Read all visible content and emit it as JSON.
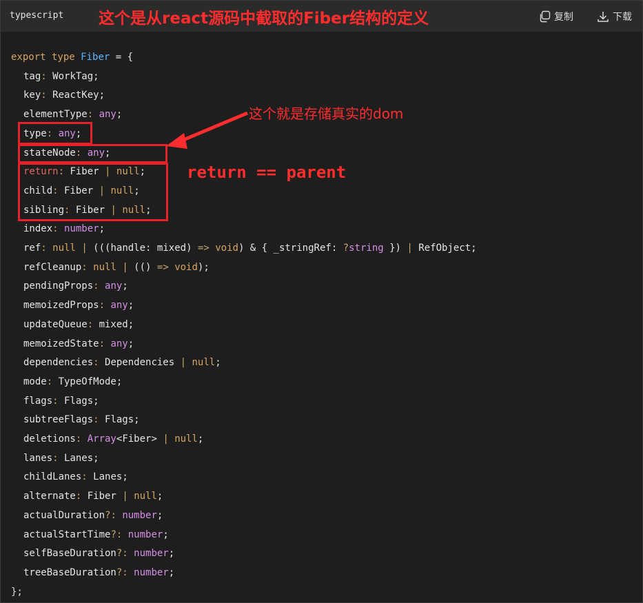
{
  "header": {
    "language": "typescript",
    "annotation": "这个是从react源码中截取的Fiber结构的定义",
    "copy_label": "复制",
    "download_label": "下载"
  },
  "annotations": {
    "dom_note": "这个就是存储真实的dom",
    "parent_note": "return == parent"
  },
  "code": {
    "open": {
      "kw": "export type",
      "name": "Fiber",
      "eq": "= {"
    },
    "fields": [
      {
        "name": "tag",
        "type": "WorkTag;"
      },
      {
        "name": "key",
        "type": "ReactKey;"
      },
      {
        "name": "elementType",
        "type": "any;"
      },
      {
        "name": "type",
        "type": "any;"
      },
      {
        "name": "stateNode",
        "type": "any;"
      },
      {
        "name": "return",
        "type": "Fiber | null;"
      },
      {
        "name": "child",
        "type": "Fiber | null;"
      },
      {
        "name": "sibling",
        "type": "Fiber | null;"
      },
      {
        "name": "index",
        "type": "number;"
      },
      {
        "name": "ref",
        "type": "null | (((handle: mixed) => void) & { _stringRef: ?string }) | RefObject;"
      },
      {
        "name": "refCleanup",
        "type": "null | (() => void);"
      },
      {
        "name": "pendingProps",
        "type": "any;"
      },
      {
        "name": "memoizedProps",
        "type": "any;"
      },
      {
        "name": "updateQueue",
        "type": "mixed;"
      },
      {
        "name": "memoizedState",
        "type": "any;"
      },
      {
        "name": "dependencies",
        "type": "Dependencies | null;"
      },
      {
        "name": "mode",
        "type": "TypeOfMode;"
      },
      {
        "name": "flags",
        "type": "Flags;"
      },
      {
        "name": "subtreeFlags",
        "type": "Flags;"
      },
      {
        "name": "deletions",
        "type": "Array<Fiber> | null;"
      },
      {
        "name": "lanes",
        "type": "Lanes;"
      },
      {
        "name": "childLanes",
        "type": "Lanes;"
      },
      {
        "name": "alternate",
        "type": "Fiber | null;"
      },
      {
        "name": "actualDuration",
        "opt": "?:",
        "type": "number;"
      },
      {
        "name": "actualStartTime",
        "opt": "?:",
        "type": "number;"
      },
      {
        "name": "selfBaseDuration",
        "opt": "?:",
        "type": "number;"
      },
      {
        "name": "treeBaseDuration",
        "opt": "?:",
        "type": "number;"
      }
    ],
    "close": "};"
  },
  "colors": {
    "annotation_red": "#ff2d2d",
    "box_red": "#e8222b",
    "background": "#1e1e1e",
    "header_bg": "#2b2b2b"
  }
}
